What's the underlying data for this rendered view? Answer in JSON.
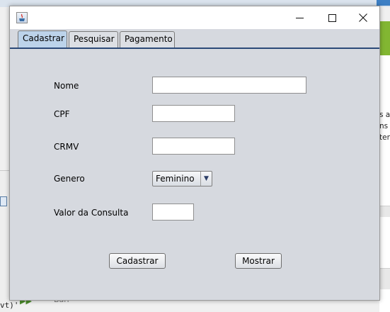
{
  "window": {
    "title": ""
  },
  "tabs": [
    {
      "label": "Cadastrar",
      "selected": true
    },
    {
      "label": "Pesquisar",
      "selected": false
    },
    {
      "label": "Pagamento",
      "selected": false
    }
  ],
  "form": {
    "nome": {
      "label": "Nome",
      "value": ""
    },
    "cpf": {
      "label": "CPF",
      "value": ""
    },
    "crmv": {
      "label": "CRMV",
      "value": ""
    },
    "genero": {
      "label": "Genero",
      "selected": "Feminino"
    },
    "valor": {
      "label": "Valor da Consulta",
      "value": ""
    }
  },
  "buttons": {
    "cadastrar": "Cadastrar",
    "mostrar": "Mostrar"
  },
  "background": {
    "right_text": "s a\nns\nter.",
    "left_text": "vt)'",
    "bottom_text": "Barr"
  },
  "colors": {
    "selected_tab": "#bcd3ea",
    "tab_underline": "#2c4a78",
    "window_bg": "#d6d9df"
  }
}
